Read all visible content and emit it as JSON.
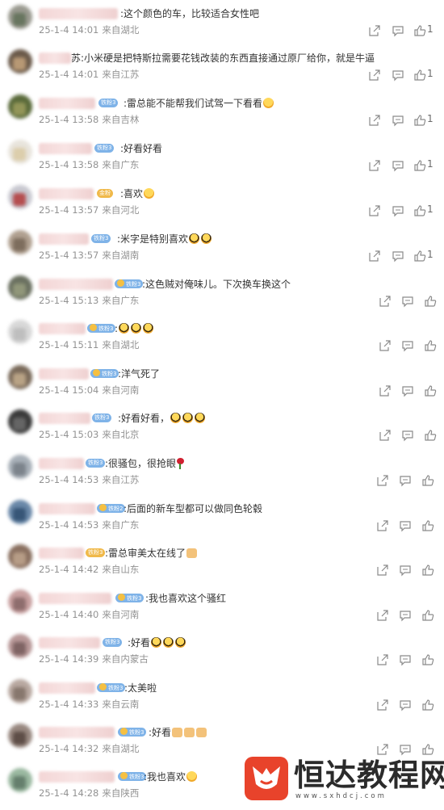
{
  "icons": {
    "share": "share-icon",
    "comment": "comment-icon",
    "like": "thumbs-up-icon"
  },
  "colors": {
    "meta_text": "#939393",
    "body_text": "#333333",
    "icon": "#8a8a8a",
    "watermark_red": "#e8432b"
  },
  "comments": [
    {
      "name_visible": "",
      "badge": "",
      "text": ":这个颜色的车，比较适合女性吧",
      "date": "25-1-4 14:01",
      "location": "来自湖北",
      "likes": "1"
    },
    {
      "name_visible": "苏",
      "badge": "",
      "text": ":小米硬是把特斯拉需要花钱改装的东西直接通过原厂给你，就是牛逼",
      "date": "25-1-4 14:01",
      "location": "来自江苏",
      "likes": "1"
    },
    {
      "name_visible": "",
      "badge": "铁粉3",
      "text": ":雷总能不能帮我们试驾一下看看",
      "date": "25-1-4 13:58",
      "location": "来自吉林",
      "likes": "1"
    },
    {
      "name_visible": "",
      "badge": "铁粉3",
      "text": ":好看好看",
      "date": "25-1-4 13:58",
      "location": "来自广东",
      "likes": "1"
    },
    {
      "name_visible": "",
      "badge": "金粉",
      "text": ":喜欢",
      "date": "25-1-4 13:57",
      "location": "来自河北",
      "likes": "1"
    },
    {
      "name_visible": "",
      "badge": "铁粉3",
      "text": ":米字是特别喜欢",
      "date": "25-1-4 13:57",
      "location": "来自湖南",
      "likes": "1"
    },
    {
      "name_visible": "",
      "badge": "铁粉3",
      "text": ":这色贼对俺味儿。下次换车换这个",
      "date": "25-1-4 15:13",
      "location": "来自广东",
      "likes": ""
    },
    {
      "name_visible": "",
      "badge": "铁粉3",
      "text": ":",
      "date": "25-1-4 15:11",
      "location": "来自湖北",
      "likes": ""
    },
    {
      "name_visible": "",
      "badge": "铁粉3",
      "text": ":洋气死了",
      "date": "25-1-4 15:04",
      "location": "来自河南",
      "likes": ""
    },
    {
      "name_visible": "",
      "badge": "铁粉3",
      "text": ":好看好看，",
      "date": "25-1-4 15:03",
      "location": "来自北京",
      "likes": ""
    },
    {
      "name_visible": "",
      "badge": "铁粉3",
      "text": ":很骚包，很抢眼",
      "date": "25-1-4 14:53",
      "location": "来自江苏",
      "likes": ""
    },
    {
      "name_visible": "",
      "badge": "铁粉2",
      "text": ":后面的新车型都可以做同色轮毂",
      "date": "25-1-4 14:53",
      "location": "来自广东",
      "likes": ""
    },
    {
      "name_visible": "",
      "badge": "铁粉3",
      "text": ":雷总审美太在线了",
      "date": "25-1-4 14:42",
      "location": "来自山东",
      "likes": ""
    },
    {
      "name_visible": "",
      "badge": "铁粉3",
      "text": ":我也喜欢这个骚红",
      "date": "25-1-4 14:40",
      "location": "来自河南",
      "likes": ""
    },
    {
      "name_visible": "",
      "badge": "铁粉3",
      "text": ":好看",
      "date": "25-1-4 14:39",
      "location": "来自内蒙古",
      "likes": ""
    },
    {
      "name_visible": "",
      "badge": "铁粉3",
      "text": ":太美啦",
      "date": "25-1-4 14:33",
      "location": "来自云南",
      "likes": ""
    },
    {
      "name_visible": "",
      "badge": "铁粉3",
      "text": ":好看",
      "date": "25-1-4 14:32",
      "location": "来自湖北",
      "likes": ""
    },
    {
      "name_visible": "",
      "badge": "铁粉3",
      "text": ":我也喜欢",
      "date": "25-1-4 14:28",
      "location": "来自陕西",
      "likes": ""
    }
  ],
  "watermark": {
    "brand": "恒达教程网",
    "url": "www.sxhdcj.com"
  }
}
